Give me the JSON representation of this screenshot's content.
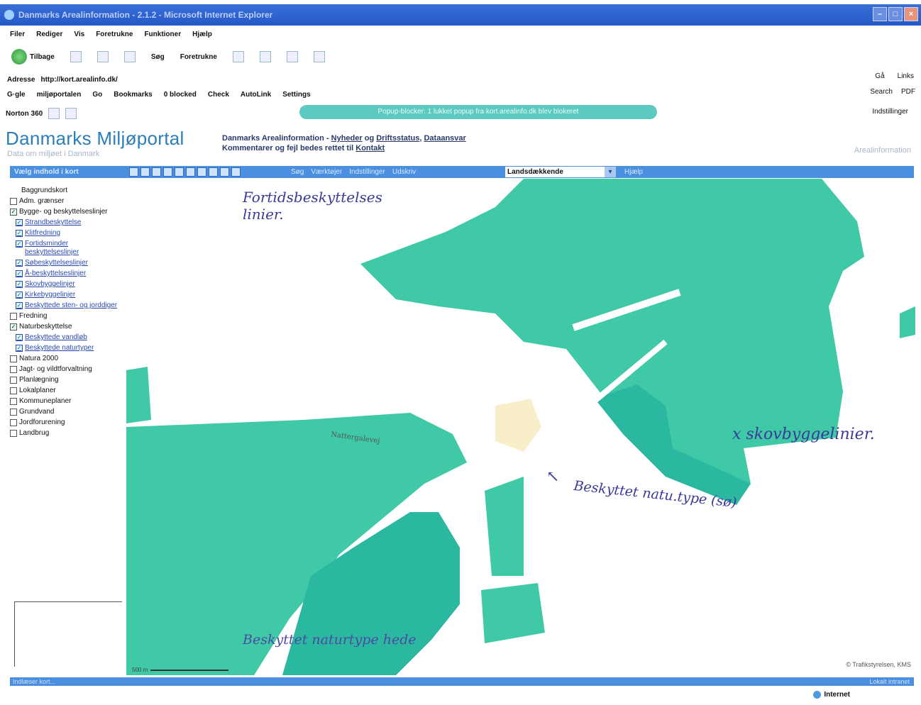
{
  "window": {
    "title": "Danmarks Arealinformation - 2.1.2 - Microsoft Internet Explorer"
  },
  "menu": [
    "Filer",
    "Rediger",
    "Vis",
    "Foretrukne",
    "Funktioner",
    "Hjælp"
  ],
  "toolbar": {
    "back": "Tilbage",
    "search": "Søg",
    "favorites": "Foretrukne"
  },
  "address": {
    "label": "Adresse",
    "url": "http://kort.arealinfo.dk/",
    "go": "Gå",
    "links": "Links"
  },
  "google": {
    "label": "G·gle",
    "search_box": "miljøportalen",
    "go": "Go",
    "bookmarks": "Bookmarks",
    "blocked": "0 blocked",
    "check": "Check",
    "autolink": "AutoLink",
    "settings": "Settings",
    "search": "Search",
    "pdf": "PDF"
  },
  "norton": {
    "label": "Norton 360",
    "popup": "Popup-blocker: 1 lukket popup fra kort.arealinfo.dk blev blokeret",
    "right": "Indstillinger"
  },
  "portal": {
    "logo": "Danmarks Miljøportal",
    "tagline": "Data om miljøet i Danmark",
    "info_line1_prefix": "Danmarks Arealinformation - ",
    "nyheder": "Nyheder",
    "og": " og ",
    "driftsstatus": "Driftsstatus",
    "dataansvar": "Dataansvar",
    "info_line2_prefix": "Kommentarer og fejl bedes rettet til ",
    "kontakt": "Kontakt",
    "right": "Arealinformation"
  },
  "maptoolbar": {
    "left": "Vælg indhold i kort",
    "menus": [
      "Søg",
      "Værktøjer",
      "Indstillinger",
      "Udskriv"
    ],
    "select": "Landsdækkende",
    "help": "Hjælp"
  },
  "layers": [
    {
      "label": "Baggrundskort",
      "checked": false,
      "sub": false,
      "nobox": true
    },
    {
      "label": "Adm. grænser",
      "checked": false,
      "sub": false
    },
    {
      "label": "Bygge- og beskyttelseslinjer",
      "checked": true,
      "sub": false
    },
    {
      "label": "Strandbeskyttelse",
      "checked": true,
      "sub": true
    },
    {
      "label": "Klitfredning",
      "checked": true,
      "sub": true
    },
    {
      "label": "Fortidsminder beskyttelseslinjer",
      "checked": true,
      "sub": true
    },
    {
      "label": "Søbeskyttelseslinjer",
      "checked": true,
      "sub": true
    },
    {
      "label": "Å-beskyttelseslinjer",
      "checked": true,
      "sub": true
    },
    {
      "label": "Skovbyggelinjer",
      "checked": true,
      "sub": true
    },
    {
      "label": "Kirkebyggelinjer",
      "checked": true,
      "sub": true
    },
    {
      "label": "Beskyttede sten- og jorddiger",
      "checked": true,
      "sub": true
    },
    {
      "label": "Fredning",
      "checked": false,
      "sub": false
    },
    {
      "label": "Naturbeskyttelse",
      "checked": true,
      "sub": false
    },
    {
      "label": "Beskyttede vandløb",
      "checked": true,
      "sub": true
    },
    {
      "label": "Beskyttede naturtyper",
      "checked": true,
      "sub": true
    },
    {
      "label": "Natura 2000",
      "checked": false,
      "sub": false
    },
    {
      "label": "Jagt- og vildtforvaltning",
      "checked": false,
      "sub": false
    },
    {
      "label": "Planlægning",
      "checked": false,
      "sub": false
    },
    {
      "label": "Lokalplaner",
      "checked": false,
      "sub": false
    },
    {
      "label": "Kommuneplaner",
      "checked": false,
      "sub": false
    },
    {
      "label": "Grundvand",
      "checked": false,
      "sub": false
    },
    {
      "label": "Jordforurening",
      "checked": false,
      "sub": false
    },
    {
      "label": "Landbrug",
      "checked": false,
      "sub": false
    }
  ],
  "map": {
    "fill_color": "#3fc9a6",
    "fill_color_dark": "#2bb8a0",
    "scale": "500 m",
    "road_label": "Nattergalevej",
    "copyright": "© Trafikstyrelsen, KMS"
  },
  "annotations": {
    "fortids": "Fortidsbeskyttelses linier.",
    "skov": "x skovbyggelinier.",
    "natur_so": "Beskyttet natu.type (sø)",
    "natur_hede": "Beskyttet naturtype hede"
  },
  "status": {
    "left": "Indlæser kort...",
    "right": "Lokalt intranet",
    "ie_zone": "Internet"
  }
}
